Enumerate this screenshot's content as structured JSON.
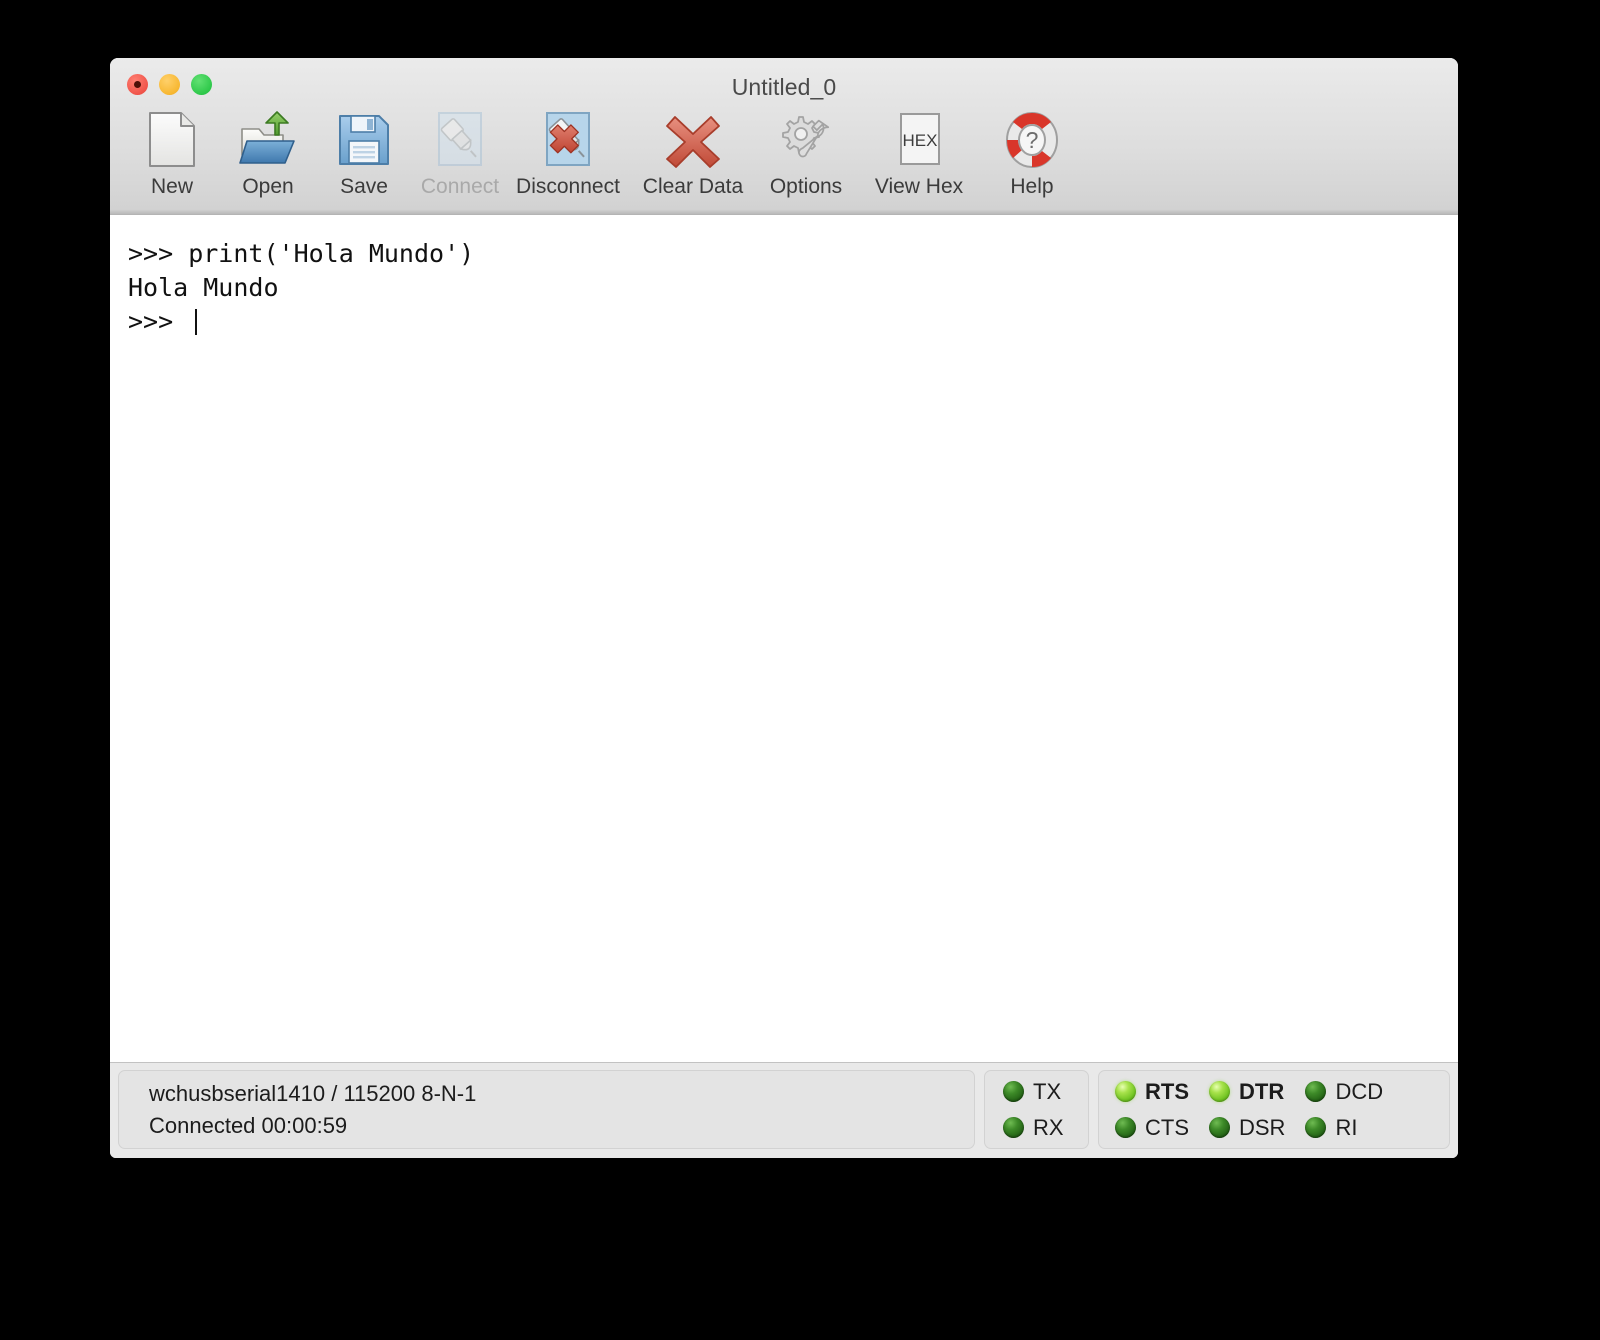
{
  "window": {
    "title": "Untitled_0",
    "traffic_lights": [
      "close",
      "minimize",
      "maximize"
    ]
  },
  "toolbar": {
    "buttons": [
      {
        "label": "New",
        "icon": "new-document-icon",
        "enabled": true
      },
      {
        "label": "Open",
        "icon": "open-folder-icon",
        "enabled": true
      },
      {
        "label": "Save",
        "icon": "floppy-disk-icon",
        "enabled": true
      },
      {
        "label": "Connect",
        "icon": "plug-connect-icon",
        "enabled": false
      },
      {
        "label": "Disconnect",
        "icon": "plug-disconnect-icon",
        "enabled": true
      },
      {
        "label": "Clear Data",
        "icon": "red-cross-icon",
        "enabled": true
      },
      {
        "label": "Options",
        "icon": "gear-wrench-icon",
        "enabled": true
      },
      {
        "label": "View Hex",
        "icon": "hex-button-icon",
        "enabled": true
      },
      {
        "label": "Help",
        "icon": "life-ring-help-icon",
        "enabled": true
      }
    ]
  },
  "terminal": {
    "lines": [
      ">>> print('Hola Mundo')",
      "Hola Mundo",
      ">>> "
    ],
    "content": ">>> print('Hola Mundo')\nHola Mundo\n>>> ",
    "cursor_visible": true
  },
  "status": {
    "port_line": "wchusbserial1410 / 115200 8-N-1",
    "connection_line": "Connected 00:00:59",
    "data_leds": [
      {
        "label": "TX",
        "state": "off",
        "bold": false
      },
      {
        "label": "RX",
        "state": "off",
        "bold": false
      }
    ],
    "signal_leds": [
      {
        "label": "RTS",
        "state": "on",
        "bold": true
      },
      {
        "label": "CTS",
        "state": "off",
        "bold": false
      },
      {
        "label": "DTR",
        "state": "on",
        "bold": true
      },
      {
        "label": "DSR",
        "state": "off",
        "bold": false
      },
      {
        "label": "DCD",
        "state": "off",
        "bold": false
      },
      {
        "label": "RI",
        "state": "off",
        "bold": false
      }
    ]
  },
  "colors": {
    "led_on": "#7fc423",
    "led_off": "#2b6b18",
    "toolbar_top": "#ebebeb",
    "toolbar_bottom": "#d2d2d2",
    "status_bg": "#e9e9e9",
    "terminal_bg": "#ffffff",
    "terminal_fg": "#111111"
  }
}
